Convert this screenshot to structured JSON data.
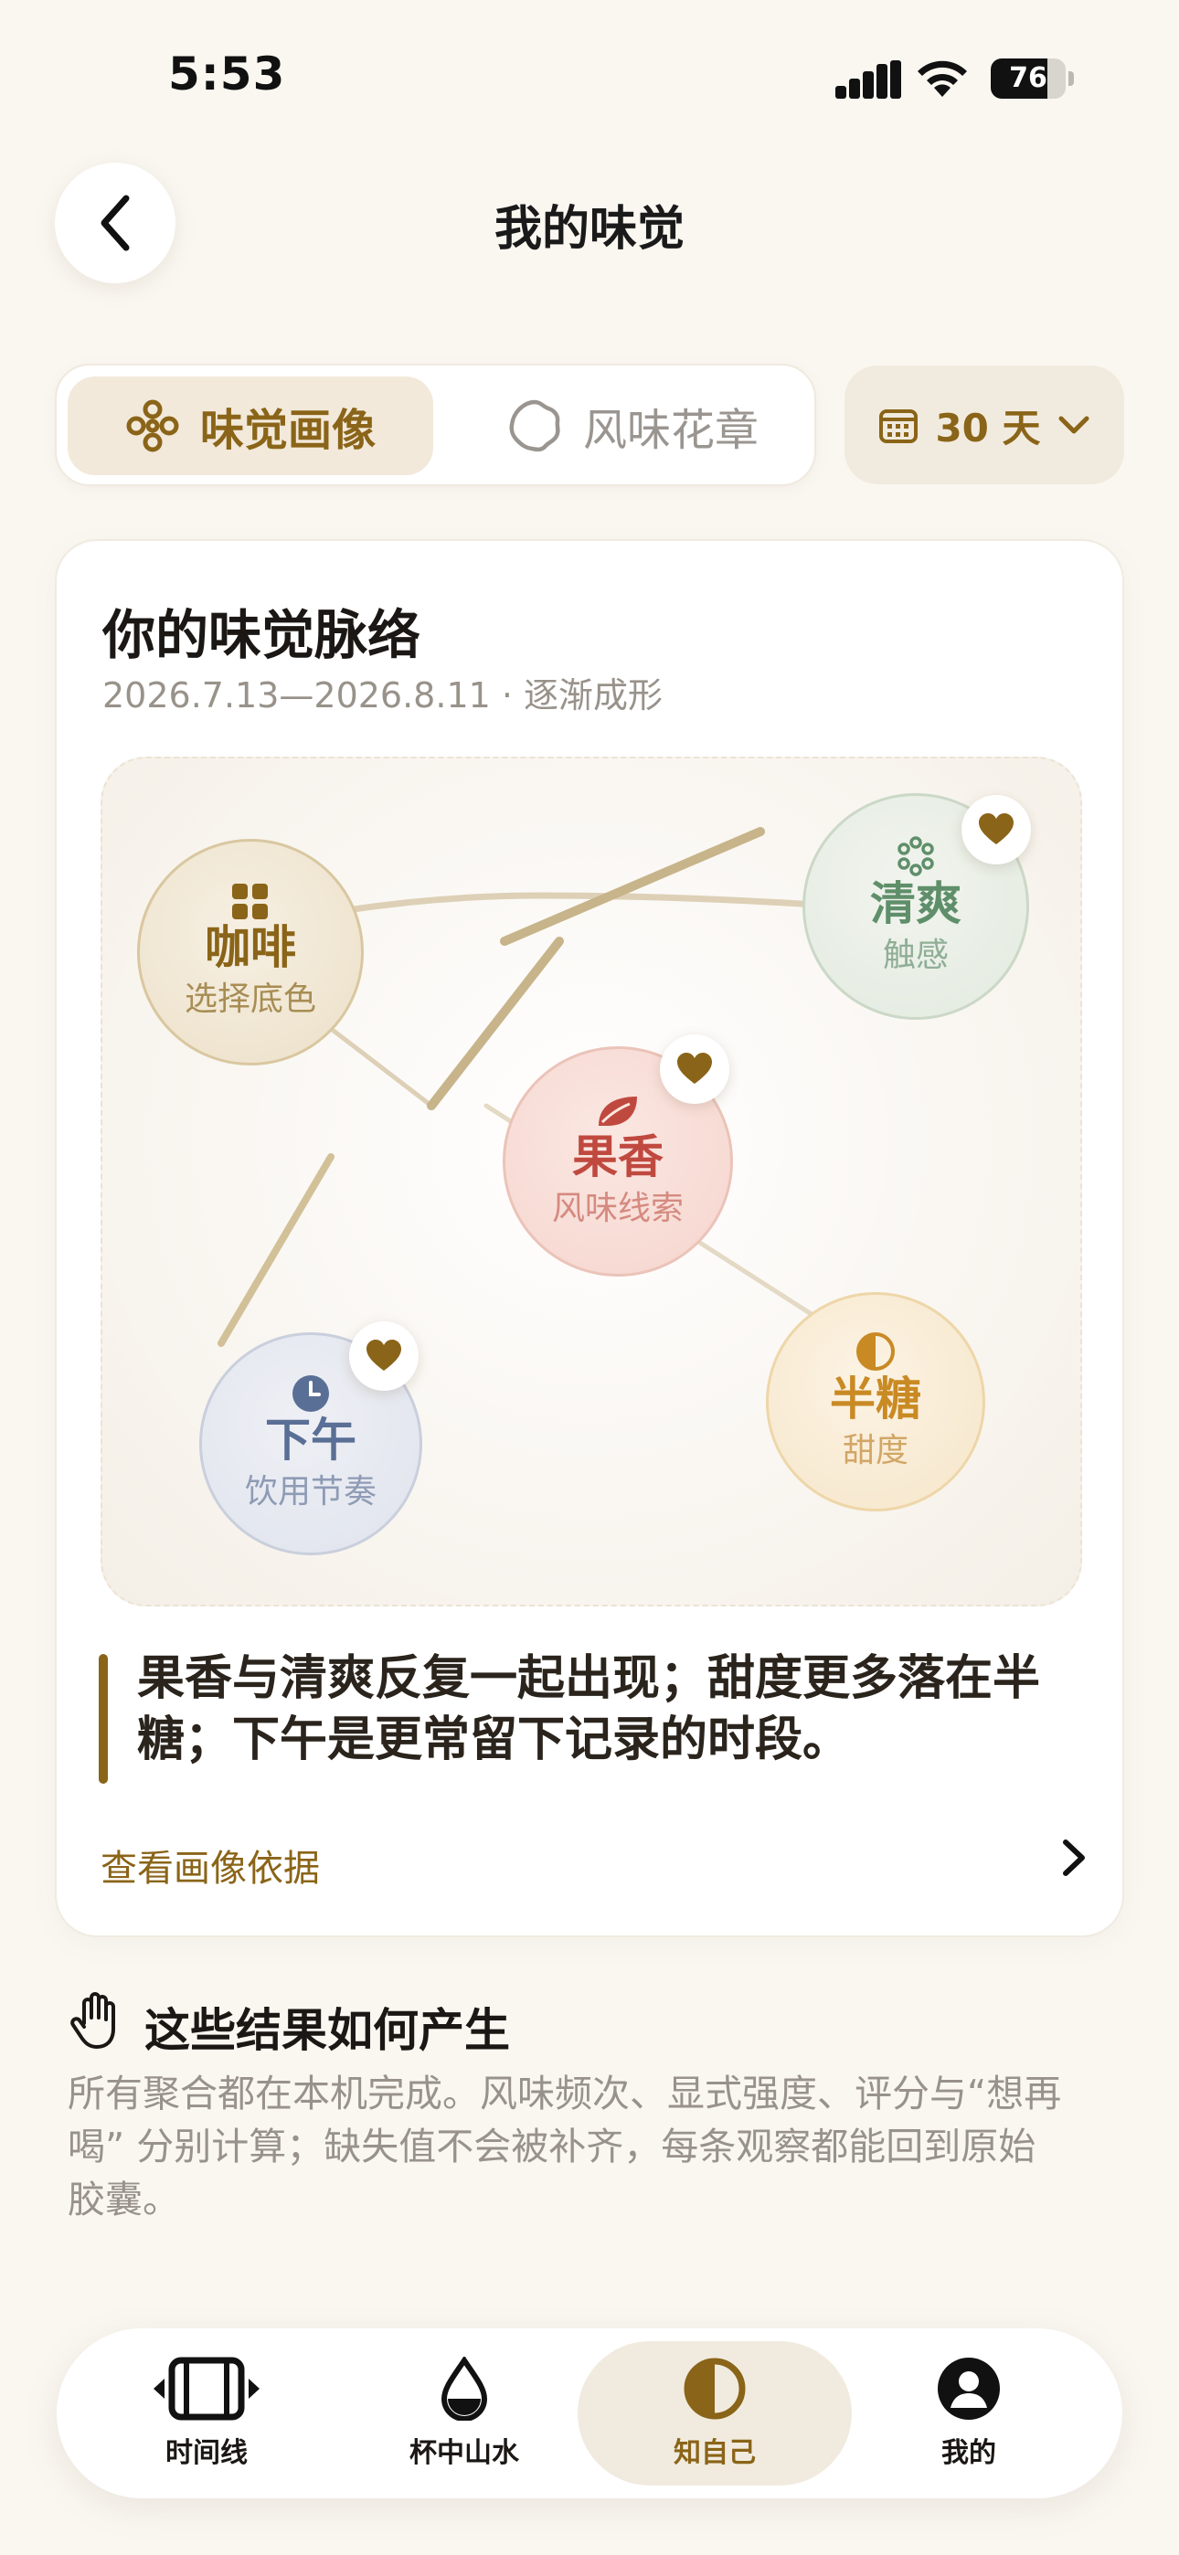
{
  "status_bar": {
    "time": "5:53",
    "battery": "76",
    "battery_level": 0.76
  },
  "header": {
    "title": "我的味觉"
  },
  "segmented": {
    "tabs": [
      {
        "label": "味觉画像",
        "icon": "flower-dots-icon",
        "active": true
      },
      {
        "label": "风味花章",
        "icon": "badge-outline-icon",
        "active": false
      }
    ]
  },
  "range": {
    "label": "30 天",
    "icon": "calendar-icon"
  },
  "card": {
    "title": "你的味觉脉络",
    "subtitle": "2026.7.13—2026.8.11 · 逐渐成形",
    "nodes": {
      "coffee": {
        "title": "咖啡",
        "sub": "选择底色",
        "color": "#8a6418"
      },
      "fresh": {
        "title": "清爽",
        "sub": "触感",
        "color": "#5f8f6a"
      },
      "fruity": {
        "title": "果香",
        "sub": "风味线索",
        "color": "#c0493f"
      },
      "afternoon": {
        "title": "下午",
        "sub": "饮用节奏",
        "color": "#5a6f96"
      },
      "half_sugar": {
        "title": "半糖",
        "sub": "甜度",
        "color": "#c98a24"
      }
    },
    "summary": "果香与清爽反复一起出现；甜度更多落在半糖；下午是更常留下记录的时段。",
    "evidence_link": "查看画像依据"
  },
  "notes": {
    "title": "这些结果如何产生",
    "body": "所有聚合都在本机完成。风味频次、显式强度、评分与“想再喝” 分别计算；缺失值不会被补齐，每条观察都能回到原始胶囊。"
  },
  "tabbar": {
    "items": [
      {
        "label": "时间线",
        "icon": "film-strip-icon",
        "active": false
      },
      {
        "label": "杯中山水",
        "icon": "water-drop-icon",
        "active": false
      },
      {
        "label": "知自己",
        "icon": "half-circle-icon",
        "active": true
      },
      {
        "label": "我的",
        "icon": "person-icon",
        "active": false
      }
    ]
  },
  "colors": {
    "accent": "#8a6418",
    "background": "#faf7f1"
  }
}
